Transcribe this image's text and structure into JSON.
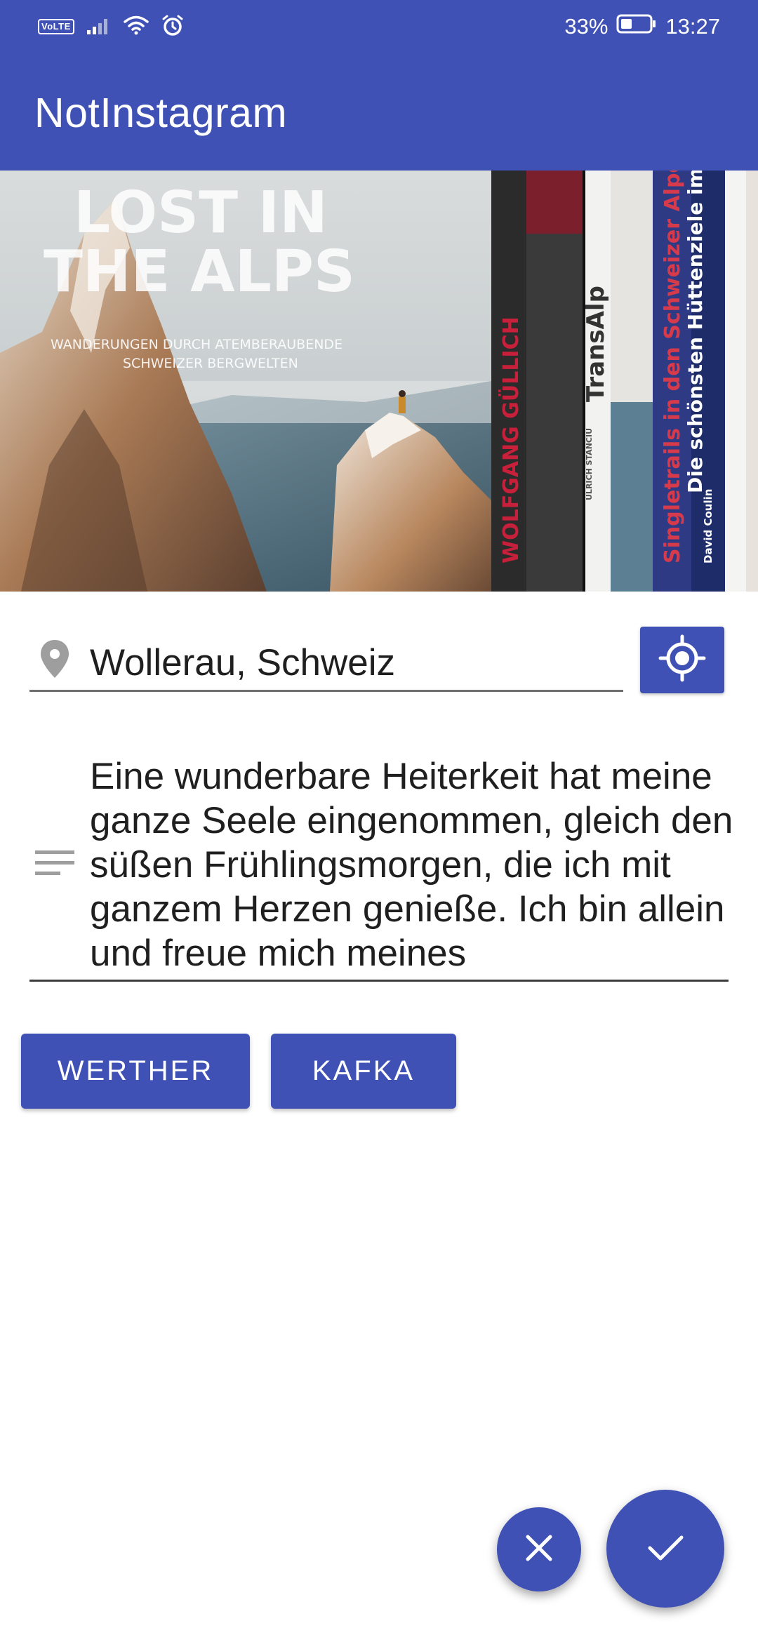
{
  "status_bar": {
    "network_badge": "VoLTE",
    "battery": "33%",
    "time": "13:27",
    "icons": [
      "signal-icon",
      "wifi-icon",
      "alarm-icon",
      "battery-icon"
    ]
  },
  "app_bar": {
    "title": "NotInstagram"
  },
  "photo": {
    "description_only": "book cover photo",
    "book_cover_text": {
      "title_line_1": "LOST IN",
      "title_line_2": "THE ALPS",
      "subtitle_line_1": "WANDERUNGEN DURCH ATEMBERAUBENDE",
      "subtitle_line_2": "SCHWEIZER BERGWELTEN"
    },
    "spines": [
      "WOLFGANG GÜLLICH",
      "TransAlp",
      "ULRICH STANCIU",
      "Singletrails in den Schweizer Alpen",
      "David Coulin",
      "Die schönsten Hüttenziele im Winter"
    ]
  },
  "location": {
    "icon": "location-pin-icon",
    "value": "Wollerau, Schweiz",
    "locate_button_icon": "gps-target-icon"
  },
  "description": {
    "icon": "notes-icon",
    "value": "Eine wunderbare Heiterkeit hat meine ganze Seele eingenommen, gleich den süßen Frühlingsmorgen, die ich mit ganzem Herzen genieße. Ich bin allein und freue mich meines"
  },
  "tags": {
    "first": "WERTHER",
    "second": "KAFKA"
  },
  "actions": {
    "cancel_icon": "close-icon",
    "confirm_icon": "check-icon"
  },
  "colors": {
    "primary": "#3f51b5",
    "on_primary": "#ffffff",
    "icon_grey": "#9e9e9e"
  }
}
